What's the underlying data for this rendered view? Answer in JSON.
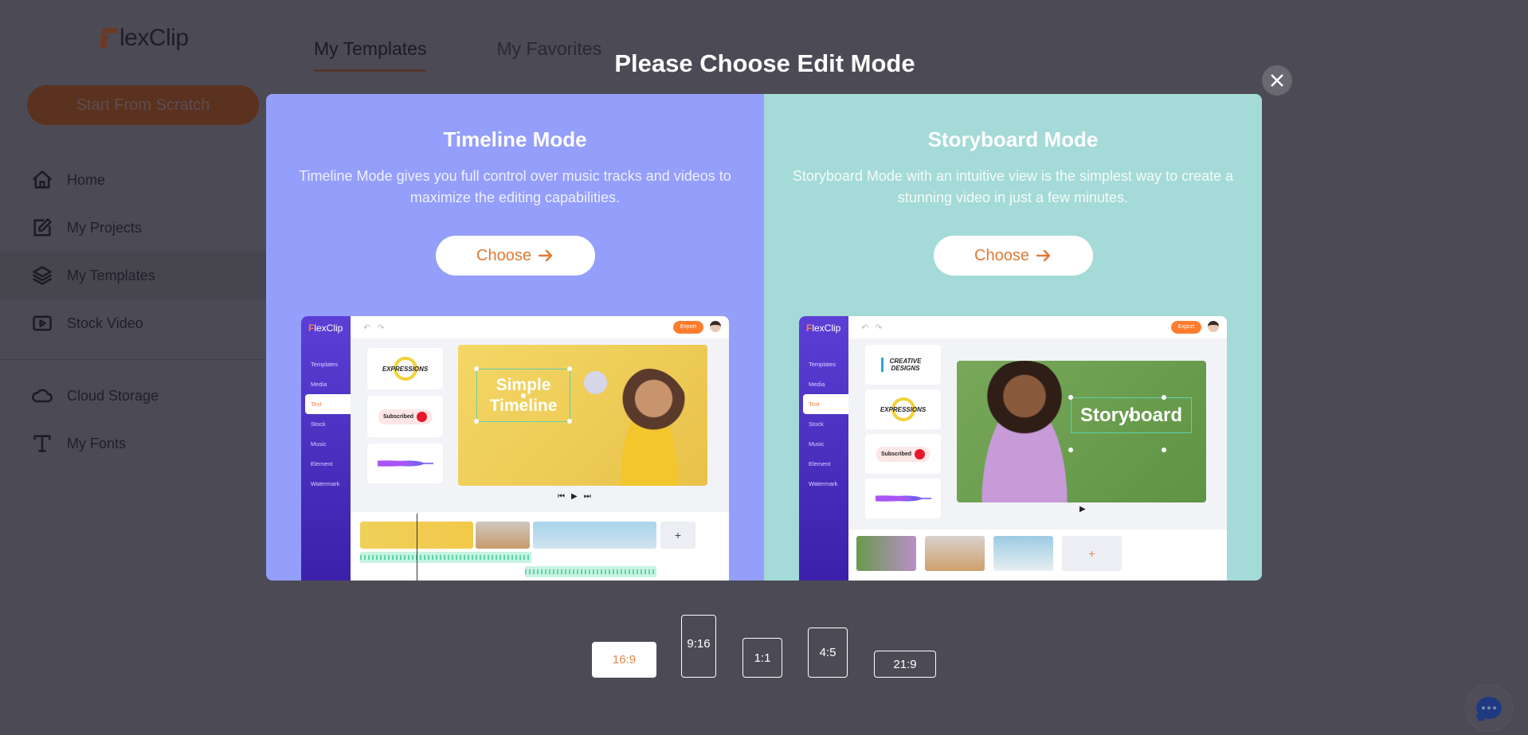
{
  "app": {
    "logo_initial": "F",
    "logo_text": "lexClip"
  },
  "sidebar": {
    "start_button": "Start From Scratch",
    "items": [
      {
        "label": "Home",
        "icon": "home-icon"
      },
      {
        "label": "My Projects",
        "icon": "edit-icon"
      },
      {
        "label": "My Templates",
        "icon": "layers-icon",
        "active": true
      },
      {
        "label": "Stock Video",
        "icon": "video-play-icon"
      },
      {
        "label": "Cloud Storage",
        "icon": "cloud-icon"
      },
      {
        "label": "My Fonts",
        "icon": "font-icon"
      }
    ]
  },
  "tabs": [
    {
      "label": "My Templates",
      "active": true
    },
    {
      "label": "My Favorites",
      "active": false
    }
  ],
  "modal": {
    "title": "Please Choose Edit Mode",
    "close_icon": "close-icon",
    "modes": [
      {
        "name": "Timeline Mode",
        "description": "Timeline Mode gives you full control over music tracks and videos to maximize the editing capabilities.",
        "button": "Choose",
        "background": "#949efb",
        "preview": {
          "logo": "FlexClip",
          "export": "Export",
          "menu": [
            "Templates",
            "Media",
            "Text",
            "Stock",
            "Music",
            "Element",
            "Watermark"
          ],
          "selected_menu": "Text",
          "cards": [
            "EXPRESSIONS",
            "Subscribed",
            "audio-wave"
          ],
          "canvas_text_line1": "Simple",
          "canvas_text_line2": "Timeline",
          "add": "+"
        }
      },
      {
        "name": "Storyboard Mode",
        "description": "Storyboard Mode with an intuitive view is the simplest way to create a stunning video in just a few minutes.",
        "button": "Choose",
        "background": "#a4dad7",
        "preview": {
          "logo": "FlexClip",
          "export": "Export",
          "menu": [
            "Templates",
            "Media",
            "Text",
            "Stock",
            "Music",
            "Element",
            "Watermark"
          ],
          "selected_menu": "Text",
          "cards": [
            "CREATIVE DESIGNS",
            "EXPRESSIONS",
            "Subscribed",
            "audio-wave"
          ],
          "canvas_text": "Storyboard",
          "add": "+"
        }
      }
    ],
    "ratios": [
      {
        "label": "16:9",
        "selected": true
      },
      {
        "label": "9:16",
        "selected": false
      },
      {
        "label": "1:1",
        "selected": false
      },
      {
        "label": "4:5",
        "selected": false
      },
      {
        "label": "21:9",
        "selected": false
      }
    ]
  },
  "colors": {
    "overlay": "#4c4b55",
    "accent_orange": "#e07a35",
    "timeline_bg": "#949efb",
    "storyboard_bg": "#a4dad7"
  }
}
